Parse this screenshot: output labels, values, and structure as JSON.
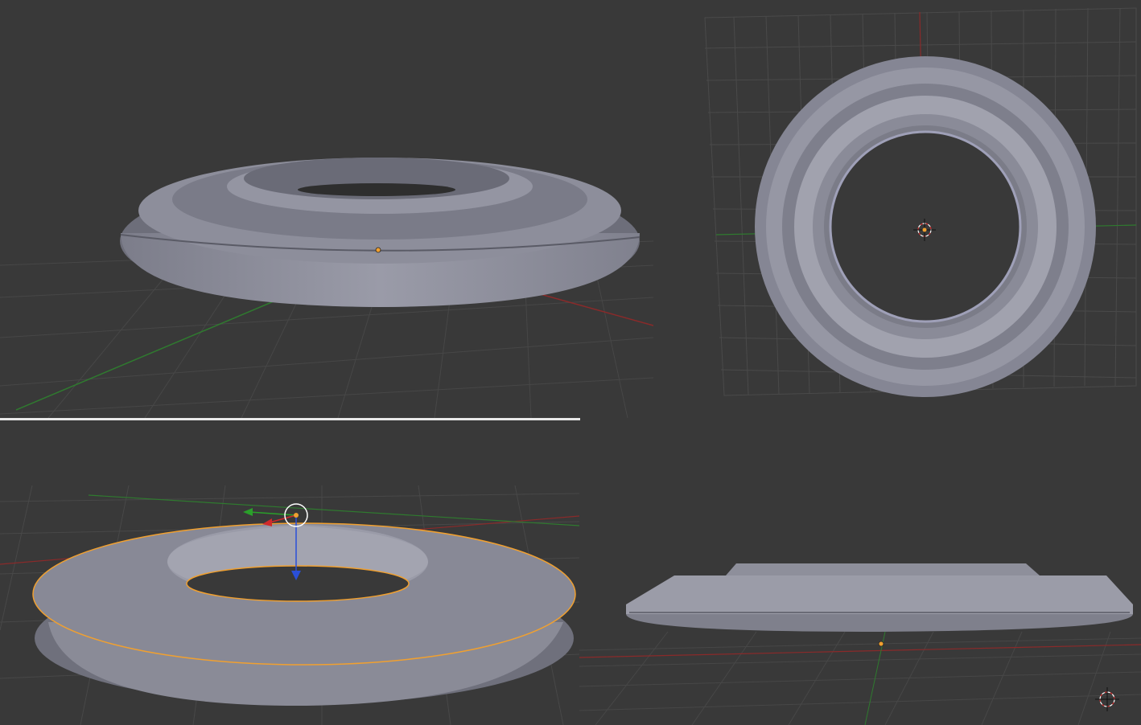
{
  "colors": {
    "background": "#393939",
    "grid": "#4a4a4a",
    "x_axis": "#8a2a2a",
    "y_axis": "#2f7a2f",
    "mesh": "#8e8f9c",
    "selection": "#f0a030",
    "origin": "#f0a030"
  },
  "viewports": [
    {
      "name": "perspective-view",
      "object": "ring-mesh"
    },
    {
      "name": "top-ortho-view",
      "object": "ring-mesh",
      "cursor": "3d-cursor-icon"
    },
    {
      "name": "selected-perspective-view",
      "object": "ring-mesh",
      "selected": true,
      "gizmo": "translate-gizmo"
    },
    {
      "name": "front-ortho-view",
      "object": "ring-mesh",
      "cursor": "3d-cursor-icon"
    }
  ]
}
